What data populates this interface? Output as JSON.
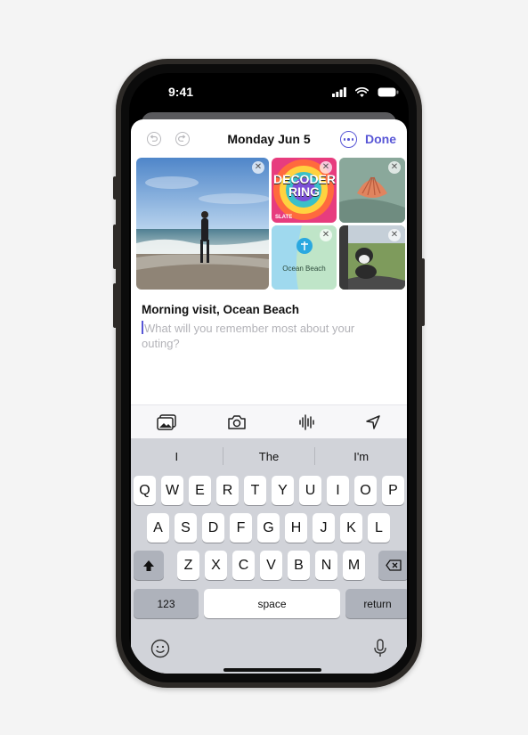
{
  "status_bar": {
    "time": "9:41"
  },
  "nav": {
    "title": "Monday Jun 5",
    "done_label": "Done"
  },
  "media": {
    "decoder_text_line1": "DECODER",
    "decoder_text_line2": "RING",
    "decoder_brand": "SLATE",
    "map_label": "Ocean Beach"
  },
  "entry": {
    "title": "Morning visit, Ocean Beach",
    "placeholder": "What will you remember most about your outing?"
  },
  "suggestions": [
    "I",
    "The",
    "I'm"
  ],
  "keyboard": {
    "row1": [
      "Q",
      "W",
      "E",
      "R",
      "T",
      "Y",
      "U",
      "I",
      "O",
      "P"
    ],
    "row2": [
      "A",
      "S",
      "D",
      "F",
      "G",
      "H",
      "J",
      "K",
      "L"
    ],
    "row3": [
      "Z",
      "X",
      "C",
      "V",
      "B",
      "N",
      "M"
    ],
    "numbers_label": "123",
    "space_label": "space",
    "return_label": "return"
  },
  "colors": {
    "accent": "#5856d6",
    "keyboard_bg": "#d1d3d9",
    "page_bg": "#f4f4f4"
  }
}
